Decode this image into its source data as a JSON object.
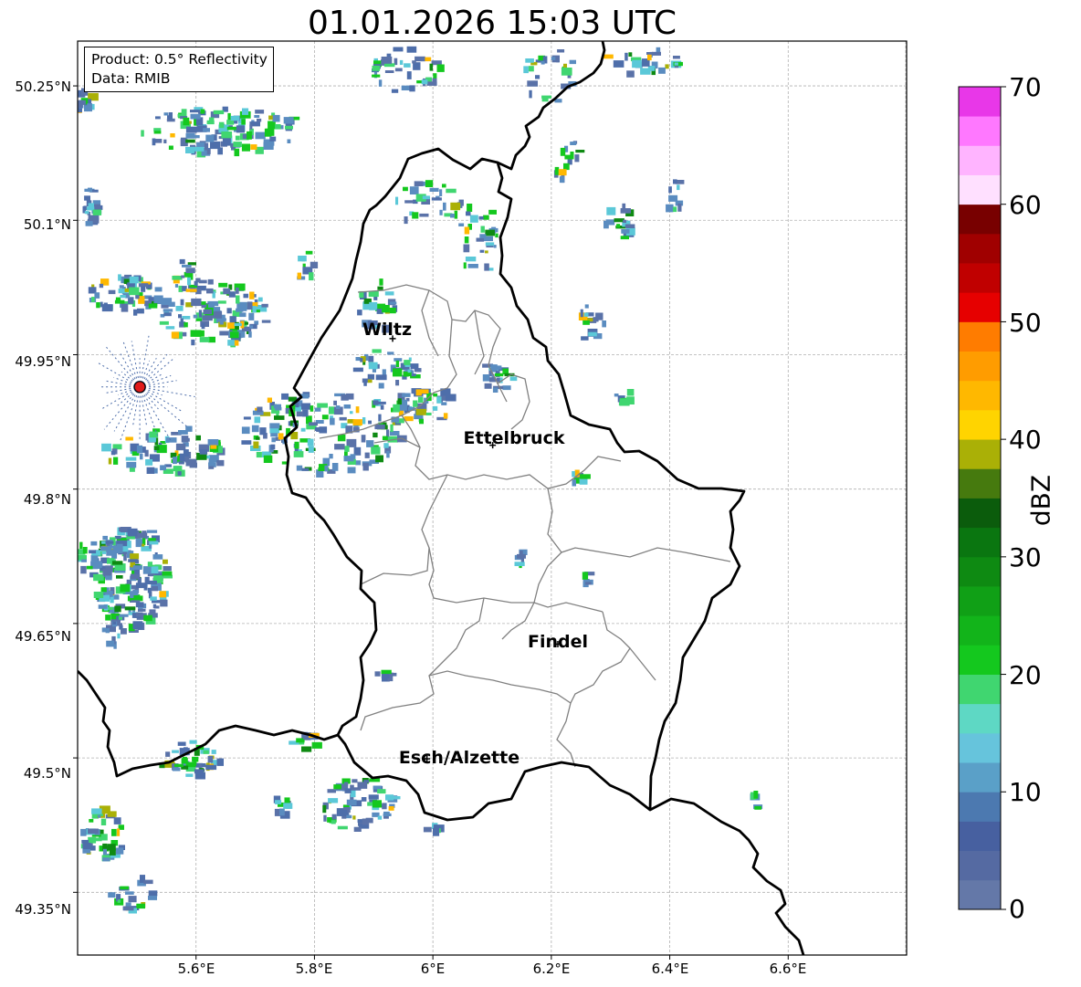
{
  "title": "01.01.2026 15:03 UTC",
  "info": {
    "product": "Product: 0.5° Reflectivity",
    "data_source": "Data: RMIB"
  },
  "map_extent": {
    "lon": [
      5.4,
      6.8
    ],
    "lat": [
      49.28,
      50.3
    ]
  },
  "y_ticks": [
    {
      "lat": 50.25,
      "label": "50.25°N"
    },
    {
      "lat": 50.1,
      "label": "50.1°N"
    },
    {
      "lat": 49.95,
      "label": "49.95°N"
    },
    {
      "lat": 49.8,
      "label": "49.8°N"
    },
    {
      "lat": 49.65,
      "label": "49.65°N"
    },
    {
      "lat": 49.5,
      "label": "49.5°N"
    },
    {
      "lat": 49.35,
      "label": "49.35°N"
    }
  ],
  "x_ticks": [
    {
      "lon": 5.6,
      "label": "5.6°E"
    },
    {
      "lon": 5.8,
      "label": "5.8°E"
    },
    {
      "lon": 6.0,
      "label": "6°E"
    },
    {
      "lon": 6.2,
      "label": "6.2°E"
    },
    {
      "lon": 6.4,
      "label": "6.4°E"
    },
    {
      "lon": 6.6,
      "label": "6.6°E"
    }
  ],
  "cities": [
    {
      "name": "Wiltz",
      "lon": 5.932,
      "lat": 49.968
    },
    {
      "name": "Ettelbruck",
      "lon": 6.101,
      "lat": 49.849
    },
    {
      "name": "Findel",
      "lon": 6.211,
      "lat": 49.627
    },
    {
      "name": "Esch/Alzette",
      "lon": 5.99,
      "lat": 49.499
    }
  ],
  "radar_site": {
    "lon": 5.505,
    "lat": 49.914
  },
  "colorbar": {
    "label": "dBZ",
    "min": 0,
    "max": 70,
    "ticks": [
      {
        "value": 70,
        "label": "70"
      },
      {
        "value": 60,
        "label": "60"
      },
      {
        "value": 50,
        "label": "50"
      },
      {
        "value": 40,
        "label": "40"
      },
      {
        "value": 30,
        "label": "30"
      },
      {
        "value": 20,
        "label": "20"
      },
      {
        "value": 10,
        "label": "10"
      },
      {
        "value": 0,
        "label": "0"
      }
    ],
    "colors": [
      "#6478a8",
      "#556aa2",
      "#4760a0",
      "#4c79b0",
      "#5aa0c8",
      "#66c4dc",
      "#5ed8c4",
      "#40d670",
      "#14c81e",
      "#12b41a",
      "#10a016",
      "#0e8a12",
      "#0a7610",
      "#0b5c0c",
      "#467a0e",
      "#aab006",
      "#ffd400",
      "#ffb800",
      "#ff9c00",
      "#ff7c00",
      "#e60000",
      "#c00000",
      "#a00000",
      "#780000",
      "#ffe0ff",
      "#ffb4ff",
      "#ff78ff",
      "#e837e8"
    ]
  },
  "echo_colors": {
    "weak": [
      "#5a72a8",
      "#4e6eaa",
      "#5a8cc0"
    ],
    "light": [
      "#5bc8d8",
      "#40d670",
      "#14c81e"
    ],
    "moderate": [
      "#0e8a12",
      "#aab006",
      "#ffb800"
    ]
  }
}
